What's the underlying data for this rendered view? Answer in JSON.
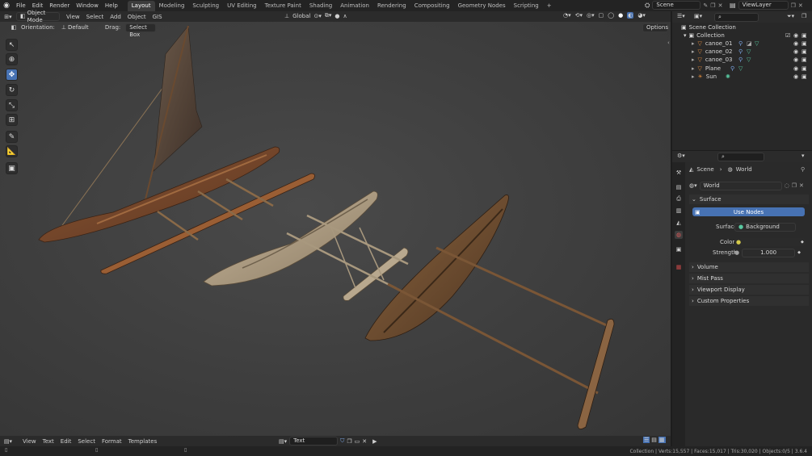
{
  "menubar": {
    "items": [
      "File",
      "Edit",
      "Render",
      "Window",
      "Help"
    ],
    "workspaces": [
      "Layout",
      "Modeling",
      "Sculpting",
      "UV Editing",
      "Texture Paint",
      "Shading",
      "Animation",
      "Rendering",
      "Compositing",
      "Geometry Nodes",
      "Scripting"
    ],
    "active_workspace": "Layout",
    "add_tab": "+",
    "scene": "Scene",
    "view_layer": "ViewLayer"
  },
  "viewport_header": {
    "mode": "Object Mode",
    "menus": [
      "View",
      "Select",
      "Add",
      "Object",
      "GIS"
    ],
    "transform_orientation": "Global"
  },
  "tool_settings": {
    "orientation_label": "Orientation:",
    "orientation_value": "Default",
    "drag_label": "Drag:",
    "drag_value": "Select Box",
    "options": "Options"
  },
  "outliner": {
    "scene_collection": "Scene Collection",
    "collection": "Collection",
    "objects": [
      {
        "name": "canoe_01"
      },
      {
        "name": "canoe_02"
      },
      {
        "name": "canoe_03"
      },
      {
        "name": "Plane"
      },
      {
        "name": "Sun"
      }
    ]
  },
  "properties": {
    "breadcrumb_scene": "Scene",
    "breadcrumb_world": "World",
    "world_name": "World",
    "surface_section": "Surface",
    "use_nodes": "Use Nodes",
    "surface_label": "Surface",
    "surface_value": "Background",
    "color_label": "Color",
    "strength_label": "Strength",
    "strength_value": "1.000",
    "collapsed_sections": [
      "Volume",
      "Mist Pass",
      "Viewport Display",
      "Custom Properties"
    ]
  },
  "text_editor": {
    "menus": [
      "View",
      "Text",
      "Edit",
      "Select",
      "Format",
      "Templates"
    ],
    "datablock": "Text"
  },
  "statusbar": {
    "text": "Collection | Verts:15,557 | Faces:15,017 | Tris:30,020 | Objects:0/5 | 3.6.4"
  },
  "colors": {
    "accent": "#4772b3",
    "mesh_icon": "#e08a3c",
    "data_icon": "#58c8a0",
    "world_color_swatch": "#d4c94a"
  }
}
